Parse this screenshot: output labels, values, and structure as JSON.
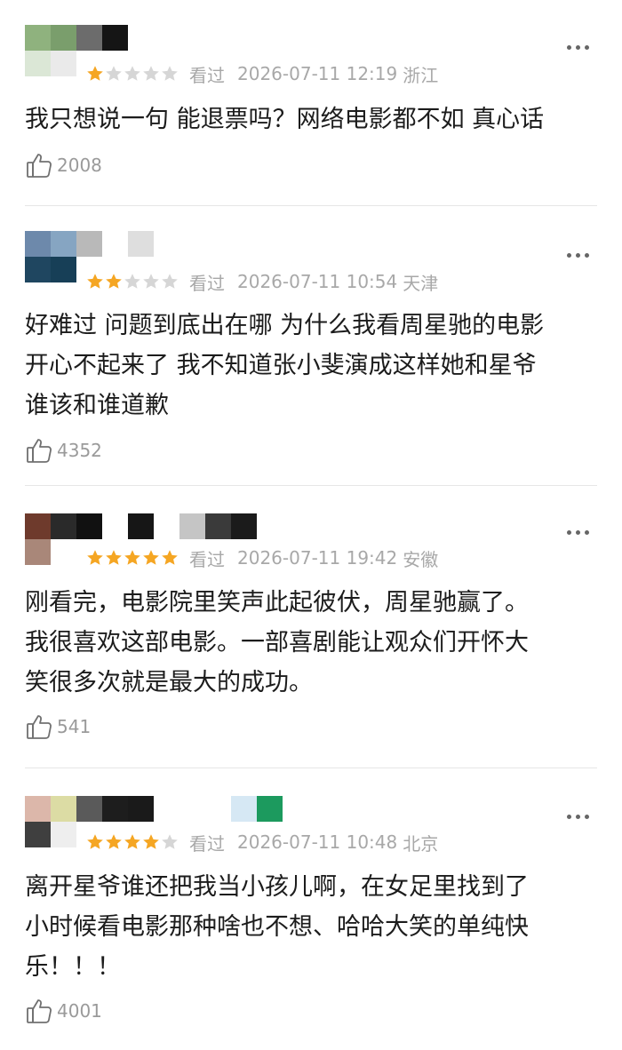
{
  "theme": {
    "star_on": "#f5a623",
    "star_off": "#d6d6d6",
    "meta_color": "#a8a8a8"
  },
  "reviews": [
    {
      "rating": 1,
      "watched_label": "看过",
      "date": "2026-07-11 12:19",
      "region": "浙江",
      "content": "我只想说一句 能退票吗？网络电影都不如 真心话",
      "likes": "2008",
      "icons": {
        "more": "more-dots-icon",
        "like": "thumbs-up-icon"
      }
    },
    {
      "rating": 2,
      "watched_label": "看过",
      "date": "2026-07-11 10:54",
      "region": "天津",
      "content": "好难过 问题到底出在哪 为什么我看周星驰的电影\n开心不起来了 我不知道张小斐演成这样她和星爷\n谁该和谁道歉",
      "likes": "4352",
      "icons": {
        "more": "more-dots-icon",
        "like": "thumbs-up-icon"
      }
    },
    {
      "rating": 5,
      "watched_label": "看过",
      "date": "2026-07-11 19:42",
      "region": "安徽",
      "content": "刚看完，电影院里笑声此起彼伏，周星驰赢了。\n我很喜欢这部电影。一部喜剧能让观众们开怀大\n笑很多次就是最大的成功。",
      "likes": "541",
      "icons": {
        "more": "more-dots-icon",
        "like": "thumbs-up-icon"
      }
    },
    {
      "rating": 4,
      "watched_label": "看过",
      "date": "2026-07-11 10:48",
      "region": "北京",
      "content": "离开星爷谁还把我当小孩儿啊，在女足里找到了\n小时候看电影那种啥也不想、哈哈大笑的单纯快\n乐！！！",
      "likes": "4001",
      "icons": {
        "more": "more-dots-icon",
        "like": "thumbs-up-icon"
      }
    }
  ]
}
